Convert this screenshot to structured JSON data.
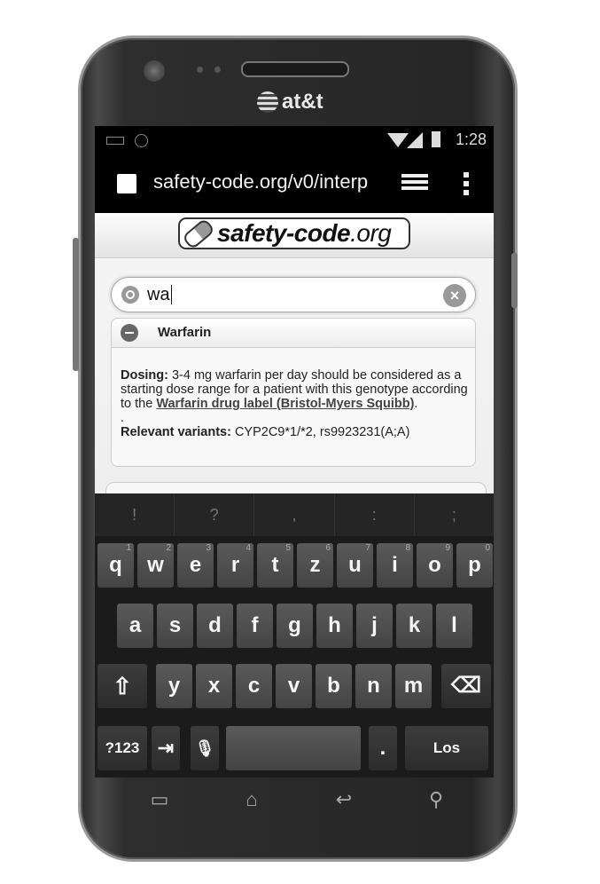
{
  "device": {
    "carrier": "at&t"
  },
  "status_bar": {
    "time": "1:28"
  },
  "browser": {
    "url": "safety-code.org/v0/interp"
  },
  "site": {
    "logo_main": "safety-code",
    "logo_tld": ".org"
  },
  "search": {
    "value": "wa"
  },
  "result": {
    "drug_name": "Warfarin",
    "dosing_label": "Dosing:",
    "dosing_text": " 3-4 mg warfarin per day should be considered as a starting dose range for a patient with this genotype according to the ",
    "dosing_link": "Warfarin drug label (Bristol-Myers Squibb)",
    "dosing_end": ".",
    "dot_line": ".",
    "variants_label": "Relevant variants:",
    "variants_value": " CYP2C9*1/*2, rs9923231(A;A)"
  },
  "keyboard": {
    "suggestions": [
      "!",
      "?",
      ",",
      ":",
      ";"
    ],
    "row1": [
      {
        "k": "q",
        "n": "1"
      },
      {
        "k": "w",
        "n": "2"
      },
      {
        "k": "e",
        "n": "3"
      },
      {
        "k": "r",
        "n": "4"
      },
      {
        "k": "t",
        "n": "5"
      },
      {
        "k": "z",
        "n": "6"
      },
      {
        "k": "u",
        "n": "7"
      },
      {
        "k": "i",
        "n": "8"
      },
      {
        "k": "o",
        "n": "9"
      },
      {
        "k": "p",
        "n": "0"
      }
    ],
    "row2": [
      "a",
      "s",
      "d",
      "f",
      "g",
      "h",
      "j",
      "k",
      "l"
    ],
    "row3": [
      "y",
      "x",
      "c",
      "v",
      "b",
      "n",
      "m"
    ],
    "symbols_key": "?123",
    "period_key": ".",
    "go_key": "Los"
  },
  "colors": {
    "screen_bg": "#000000",
    "keyboard_bg": "#1b1b1b",
    "key_bg": "#4d4d4d"
  }
}
